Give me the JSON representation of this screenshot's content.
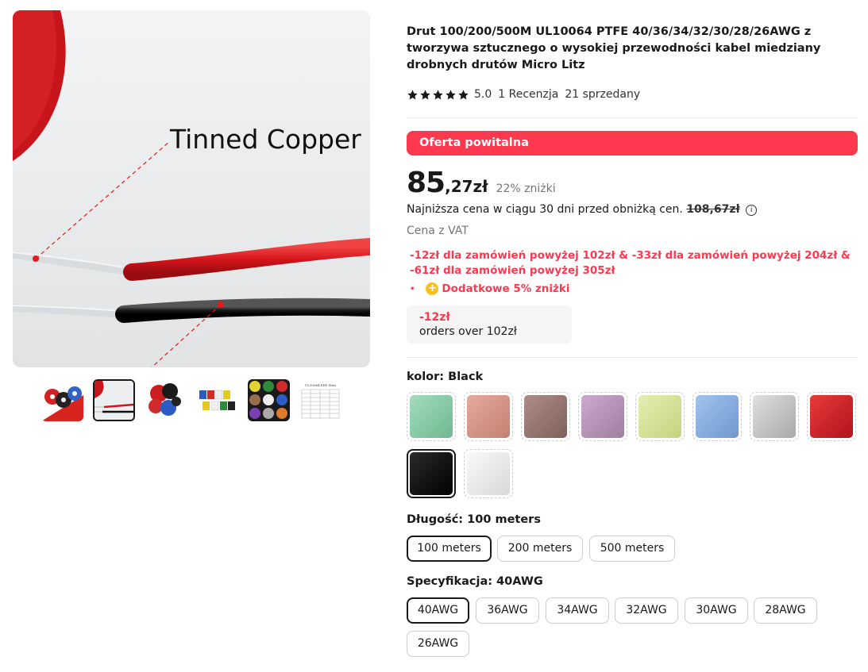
{
  "gallery": {
    "main_image_text": "Tinned Copper",
    "thumbnails": [
      {
        "name": "thumb-spools-colors",
        "active": false
      },
      {
        "name": "thumb-tinned-copper",
        "active": true
      },
      {
        "name": "thumb-spools-red-black",
        "active": false
      },
      {
        "name": "thumb-spools-row",
        "active": false
      },
      {
        "name": "thumb-spools-grid",
        "active": false
      },
      {
        "name": "thumb-spec-table",
        "active": false
      }
    ],
    "spec_table_title": "UL10064 FEP Wire"
  },
  "product": {
    "title": "Drut 100/200/500M UL10064 PTFE 40/36/34/32/30/28/26AWG z tworzywa sztucznego o wysokiej przewodności kabel miedziany drobnych drutów Micro Litz",
    "rating": "5.0",
    "reviews": "1 Recenzja",
    "sold": "21 sprzedany",
    "stars": 5
  },
  "offer": {
    "banner": "Oferta powitalna",
    "price_int": "85",
    "price_dec": ",27zł",
    "discount": "22% zniżki",
    "lowest_label": "Najniższa cena w ciągu 30 dni przed obniżką cen.",
    "lowest_price": "108,67zł",
    "vat": "Cena z VAT",
    "tiers": "-12zł dla zamówień powyżej 102zł & -33zł dla zamówień powyżej 204zł & -61zł dla zamówień powyżej 305zł",
    "extra": "Dodatkowe 5% zniżki",
    "coupon_amount": "-12zł",
    "coupon_text": "orders over 102zł"
  },
  "color": {
    "label": "kolor: ",
    "value": "Black",
    "swatches": [
      {
        "name": "green",
        "color": "#86c9a6",
        "selected": false
      },
      {
        "name": "salmon",
        "color": "#d5978a",
        "selected": false
      },
      {
        "name": "brown",
        "color": "#9b7a74",
        "selected": false
      },
      {
        "name": "purple",
        "color": "#b796b8",
        "selected": false
      },
      {
        "name": "yellow",
        "color": "#d8e39a",
        "selected": false
      },
      {
        "name": "blue",
        "color": "#86aee0",
        "selected": false
      },
      {
        "name": "gray",
        "color": "#c7c7c7",
        "selected": false
      },
      {
        "name": "red",
        "color": "#d3232a",
        "selected": false
      },
      {
        "name": "black",
        "color": "#111111",
        "selected": true
      },
      {
        "name": "white",
        "color": "#ececec",
        "selected": false
      }
    ]
  },
  "length": {
    "label": "Długość: ",
    "value": "100 meters",
    "options": [
      "100 meters",
      "200 meters",
      "500 meters"
    ]
  },
  "spec": {
    "label": "Specyfikacja: ",
    "value": "40AWG",
    "options": [
      "40AWG",
      "36AWG",
      "34AWG",
      "32AWG",
      "30AWG",
      "28AWG",
      "26AWG"
    ]
  }
}
